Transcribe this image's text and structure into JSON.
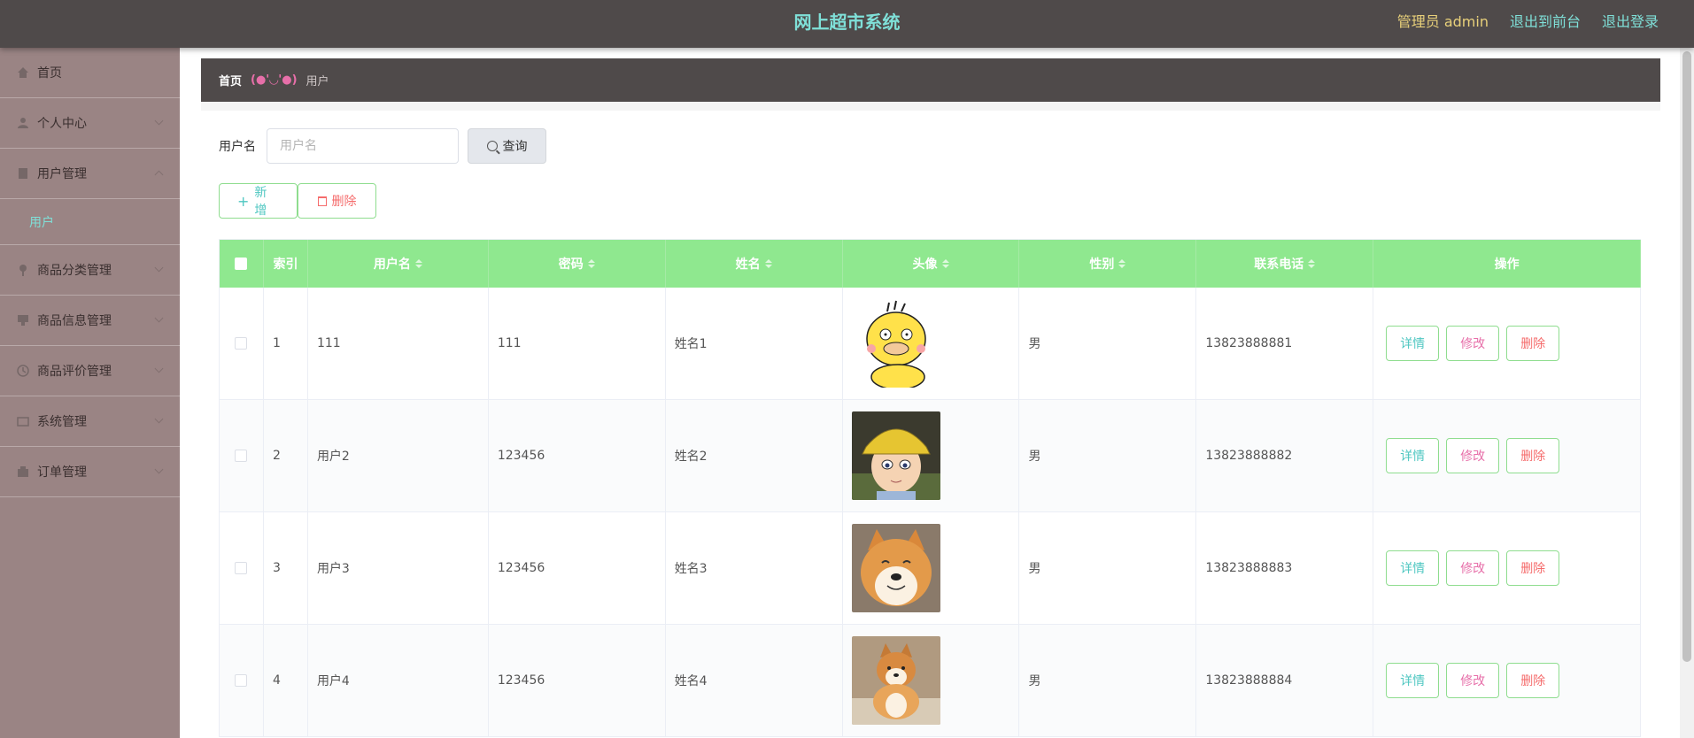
{
  "header": {
    "title": "网上超市系统",
    "admin_label": "管理员 admin",
    "front_link": "退出到前台",
    "logout_link": "退出登录"
  },
  "sidebar": {
    "items": [
      {
        "label": "首页",
        "icon": "home-icon",
        "expandable": false
      },
      {
        "label": "个人中心",
        "icon": "user-icon",
        "expandable": true
      },
      {
        "label": "用户管理",
        "icon": "document-icon",
        "expandable": true,
        "expanded": true,
        "children": [
          {
            "label": "用户"
          }
        ]
      },
      {
        "label": "商品分类管理",
        "icon": "pin-icon",
        "expandable": true
      },
      {
        "label": "商品信息管理",
        "icon": "chat-icon",
        "expandable": true
      },
      {
        "label": "商品评价管理",
        "icon": "star-icon",
        "expandable": true
      },
      {
        "label": "系统管理",
        "icon": "folder-icon",
        "expandable": true
      },
      {
        "label": "订单管理",
        "icon": "order-icon",
        "expandable": true
      }
    ]
  },
  "breadcrumb": {
    "home": "首页",
    "separator": "(●'◡'●)",
    "current": "用户"
  },
  "search": {
    "label": "用户名",
    "placeholder": "用户名",
    "value": "",
    "button": "查询"
  },
  "actions": {
    "add": "新增",
    "delete": "删除"
  },
  "table": {
    "headers": [
      "索引",
      "用户名",
      "密码",
      "姓名",
      "头像",
      "性别",
      "联系电话",
      "操作"
    ],
    "rows": [
      {
        "index": "1",
        "username": "111",
        "password": "111",
        "name": "姓名1",
        "avatar": "psyduck",
        "gender": "男",
        "phone": "13823888881"
      },
      {
        "index": "2",
        "username": "用户2",
        "password": "123456",
        "name": "姓名2",
        "avatar": "conan",
        "gender": "男",
        "phone": "13823888882"
      },
      {
        "index": "3",
        "username": "用户3",
        "password": "123456",
        "name": "姓名3",
        "avatar": "shiba-smile",
        "gender": "男",
        "phone": "13823888883"
      },
      {
        "index": "4",
        "username": "用户4",
        "password": "123456",
        "name": "姓名4",
        "avatar": "shiba-sit",
        "gender": "男",
        "phone": "13823888884"
      }
    ],
    "row_actions": {
      "detail": "详情",
      "edit": "修改",
      "remove": "删除"
    }
  },
  "colors": {
    "topbar": "#4f4a4a",
    "sidebar": "#9a8484",
    "accent": "#7fe0d8",
    "table_header": "#8fe88f"
  }
}
